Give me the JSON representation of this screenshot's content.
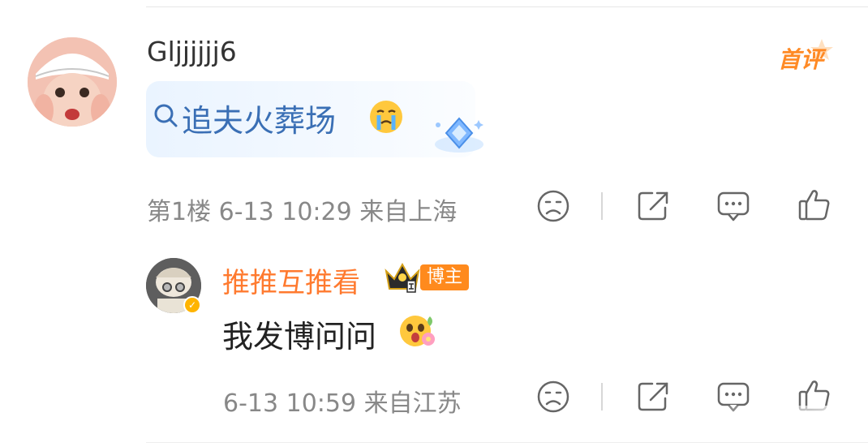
{
  "comment": {
    "username": "Gljjjjjj6",
    "badge_label": "首评",
    "query_text": "追夫火葬场",
    "meta": "第1楼 6-13 10:29 来自上海"
  },
  "reply": {
    "username": "推推互推看",
    "role_badge": "博主",
    "text": "我发博问问",
    "meta": "6-13 10:59 来自江苏"
  },
  "icons": {
    "search": "search-icon",
    "dislike": "frown-face-icon",
    "share": "share-icon",
    "comment": "comment-bubble-icon",
    "like": "thumbs-up-icon"
  },
  "colors": {
    "username_orange": "#ff7a2f",
    "query_blue": "#3a6fb5",
    "meta_gray": "#888888",
    "badge_orange": "#ff8a1d"
  }
}
